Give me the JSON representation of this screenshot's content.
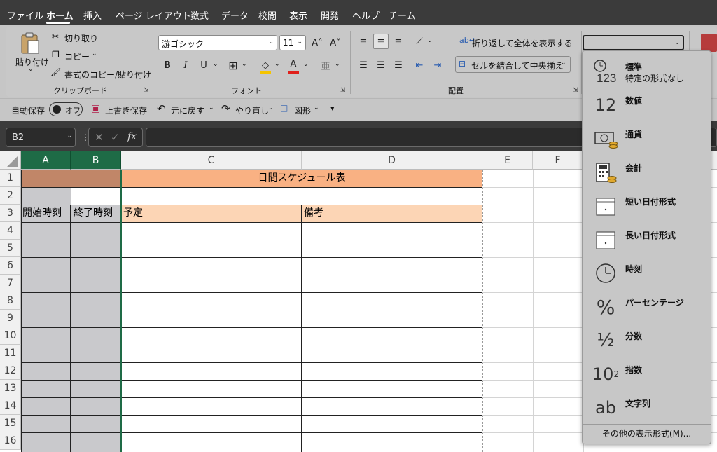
{
  "menu": {
    "tabs": [
      "ファイル",
      "ホーム",
      "挿入",
      "ページ レイアウト",
      "数式",
      "データ",
      "校閲",
      "表示",
      "開発",
      "ヘルプ",
      "チーム"
    ]
  },
  "clipboard": {
    "paste": "貼り付け",
    "cut": "切り取り",
    "copy": "コピー",
    "format_painter": "書式のコピー/貼り付け",
    "group": "クリップボード"
  },
  "font": {
    "name": "游ゴシック",
    "size": "11",
    "grow": "A˄",
    "shrink": "A˅",
    "bold": "B",
    "italic": "I",
    "underline": "U",
    "group": "フォント"
  },
  "alignment": {
    "wrap": "折り返して全体を表示する",
    "merge": "セルを結合して中央揃え",
    "group": "配置"
  },
  "number_format_box": {
    "value": ""
  },
  "qat": {
    "autosave": "自動保存",
    "toggle": "オフ",
    "save": "上書き保存",
    "undo": "元に戻す",
    "redo": "やり直し",
    "shapes": "図形"
  },
  "formula": {
    "namebox": "B2",
    "fx": "fx",
    "content": ""
  },
  "columns": [
    "A",
    "B",
    "C",
    "D",
    "E",
    "F"
  ],
  "rows": [
    "1",
    "2",
    "3",
    "4",
    "5",
    "6",
    "7",
    "8",
    "9",
    "10",
    "11",
    "12",
    "13",
    "14",
    "15",
    "16"
  ],
  "cells": {
    "c1": "日間スケジュール表",
    "a3": "開始時刻",
    "b3": "終了時刻",
    "c3": "予定",
    "d3": "備考"
  },
  "format_menu": {
    "items": [
      {
        "label": "標準",
        "sub": "特定の形式なし",
        "icon": "clock-123-icon"
      },
      {
        "label": "数値",
        "icon": "number-12-icon"
      },
      {
        "label": "通貨",
        "icon": "currency-icon"
      },
      {
        "label": "会計",
        "icon": "calculator-icon"
      },
      {
        "label": "短い日付形式",
        "icon": "calendar-short-icon"
      },
      {
        "label": "長い日付形式",
        "icon": "calendar-long-icon"
      },
      {
        "label": "時刻",
        "icon": "clock-icon"
      },
      {
        "label": "パーセンテージ",
        "icon": "percent-icon"
      },
      {
        "label": "分数",
        "icon": "fraction-icon"
      },
      {
        "label": "指数",
        "icon": "exponent-icon"
      },
      {
        "label": "文字列",
        "icon": "text-ab-icon"
      }
    ],
    "more": "その他の表示形式(M)..."
  },
  "colors": {
    "header_fill": "#f9b183",
    "cell_fill": "#fcd5b5",
    "selected_header": "#1e6b46",
    "gray_cells": "#c9c9cc",
    "brown_merge": "#c18668"
  }
}
